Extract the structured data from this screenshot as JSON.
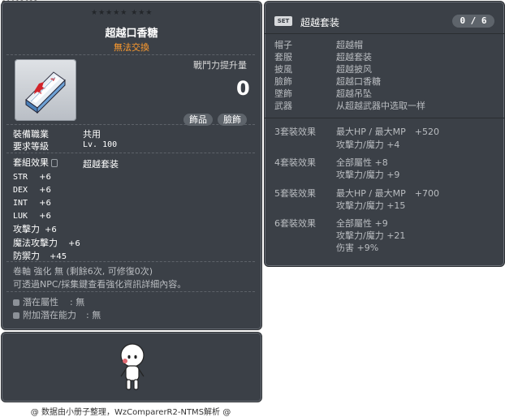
{
  "item_id": "01012622",
  "item": {
    "stars_row": "★★★★★  ★★★",
    "name": "超越口香糖",
    "sub": "無法交換",
    "power_label": "戰鬥力提升量",
    "power_value": "0",
    "tags": [
      "飾品",
      "臉飾"
    ],
    "job_label": "裝備職業",
    "job_value": "共用",
    "level_label": "要求等級",
    "level_value": "Lv. 100",
    "set_label": "套組效果",
    "set_value": "超越套装",
    "stats": [
      {
        "name": "STR",
        "value": "+6"
      },
      {
        "name": "DEX",
        "value": "+6"
      },
      {
        "name": "INT",
        "value": "+6"
      },
      {
        "name": "LUK",
        "value": "+6"
      },
      {
        "name": "攻擊力",
        "value": "+6"
      },
      {
        "name": "魔法攻擊力",
        "value": "+6"
      },
      {
        "name": "防禦力",
        "value": "+45"
      }
    ],
    "upgrade_line": "卷軸 強化 無 (剩餘6次, 可修復0次)",
    "hint_line": "可透過NPC/採集鍵查看強化資訊詳細內容。",
    "potential_label": "潛在屬性",
    "potential_value": ": 無",
    "bonus_potential_label": "附加潛在能力",
    "bonus_potential_value": ": 無"
  },
  "set": {
    "badge": "SET",
    "title": "超越套装",
    "count": "0 / 6",
    "pieces": [
      {
        "slot": "帽子",
        "name": "超越帽"
      },
      {
        "slot": "套服",
        "name": "超越套装"
      },
      {
        "slot": "披風",
        "name": "超越披风"
      },
      {
        "slot": "臉飾",
        "name": "超越口香糖"
      },
      {
        "slot": "墜飾",
        "name": "超越吊坠"
      },
      {
        "slot": "武器",
        "name": "从超越武器中选取一样"
      }
    ],
    "effects": [
      {
        "label": "3套裝效果",
        "lines": [
          "最大HP / 最大MP　+520",
          "攻擊力/魔力 +4"
        ]
      },
      {
        "label": "4套裝效果",
        "lines": [
          "全部屬性 +8",
          "攻擊力/魔力 +9"
        ]
      },
      {
        "label": "5套裝效果",
        "lines": [
          "最大HP / 最大MP　+700",
          "攻擊力/魔力 +15"
        ]
      },
      {
        "label": "6套裝效果",
        "lines": [
          "全部屬性 +9",
          "攻擊力/魔力 +21",
          "伤害 +9%"
        ]
      }
    ]
  },
  "footer": "@ 数据由小册子整理，WzComparerR2-NTMS解析 @"
}
